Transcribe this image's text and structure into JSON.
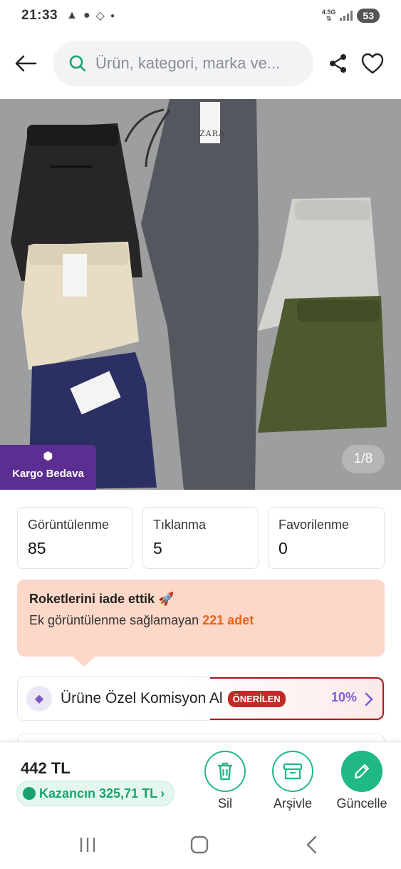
{
  "status_bar": {
    "time": "21:33",
    "network": "4.5G",
    "battery": "53",
    "left_icons": [
      "warning-icon",
      "chat-bubble-icon",
      "tag-icon",
      "dot-icon"
    ]
  },
  "header": {
    "search_placeholder": "Ürün, kategori, marka ve...",
    "icons": [
      "back-arrow-icon",
      "search-icon",
      "share-icon",
      "heart-icon"
    ]
  },
  "product_image": {
    "brand_tag_text": "ZARA",
    "cargo_badge": "Kargo Bedava",
    "pager": "1/8"
  },
  "stats": [
    {
      "label": "Görüntülenme",
      "value": "85"
    },
    {
      "label": "Tıklanma",
      "value": "5"
    },
    {
      "label": "Favorilenme",
      "value": "0"
    }
  ],
  "rocket_info": {
    "title": "Roketlerini iade ettik 🚀",
    "text_prefix": "Ek görüntülenme sağlamayan ",
    "highlight": "221 adet"
  },
  "commission": {
    "title": "Ürüne Özel Komisyon Al",
    "badge": "ÖNERİLEN",
    "percent": "10%"
  },
  "bottom_bar": {
    "price": "442 TL",
    "earnings": "Kazancın 325,71 TL",
    "actions": [
      {
        "label": "Sil",
        "icon": "trash-icon"
      },
      {
        "label": "Arşivle",
        "icon": "archive-icon"
      },
      {
        "label": "Güncelle",
        "icon": "pencil-icon"
      }
    ]
  },
  "colors": {
    "accent_green": "#20b886",
    "cargo_purple": "#5c2e91",
    "rocket_bg": "#fdd7c7",
    "highlight_orange": "#e8631a",
    "badge_red": "#c62828",
    "percent_purple": "#7b5ed6"
  }
}
